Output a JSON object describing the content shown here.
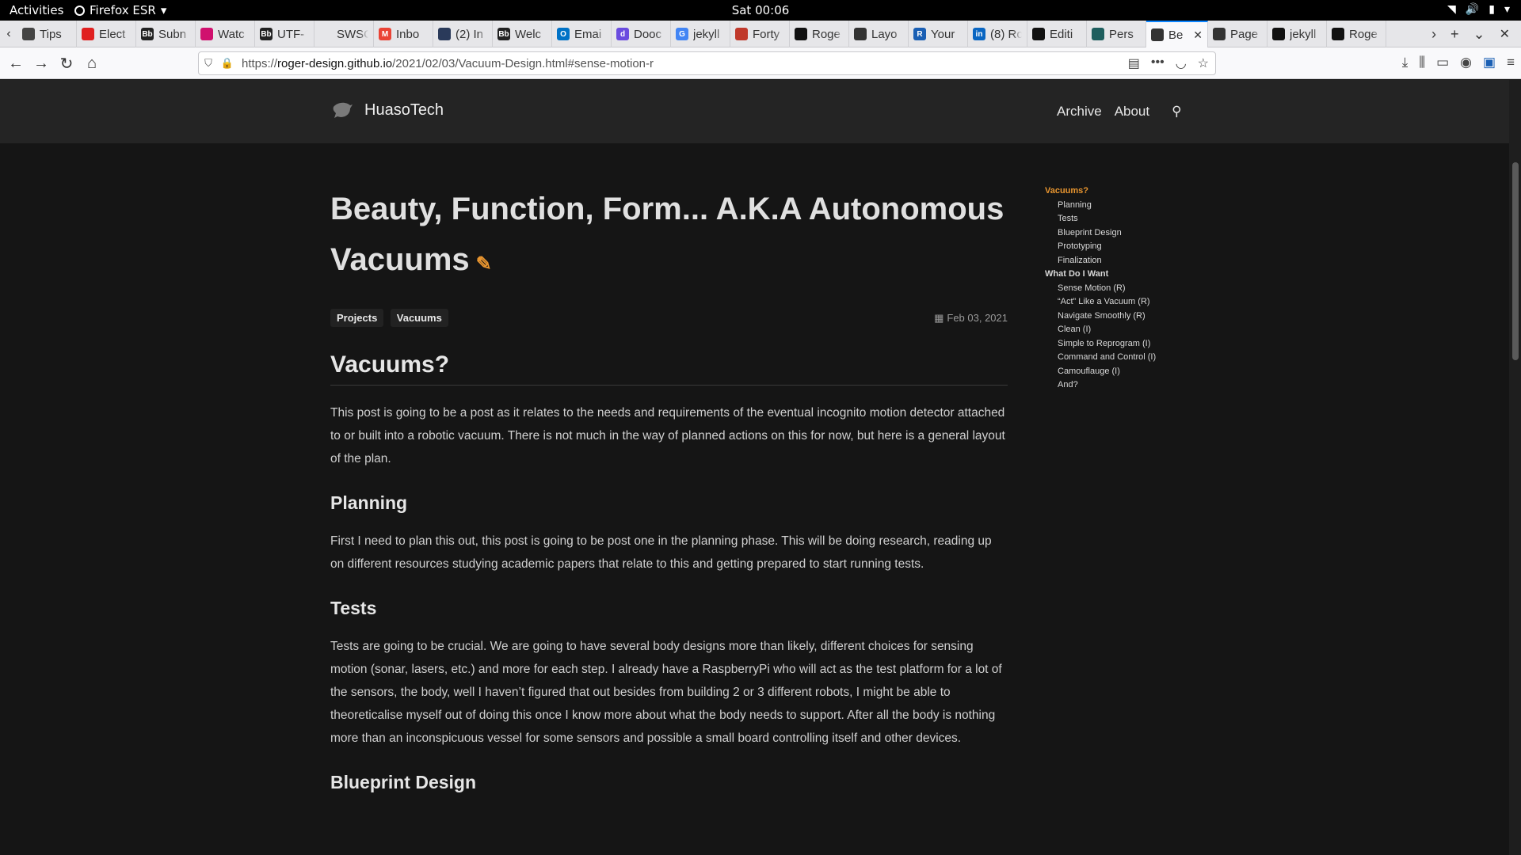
{
  "system": {
    "activities": "Activities",
    "app_name": "Firefox ESR",
    "clock": "Sat 00:06"
  },
  "tabs": [
    {
      "label": "Tips",
      "fav": "",
      "color": "#444444"
    },
    {
      "label": "Elect",
      "fav": "",
      "color": "#e02020"
    },
    {
      "label": "Subn",
      "fav": "Bb",
      "color": "#222222"
    },
    {
      "label": "Watc",
      "fav": "",
      "color": "#d0106e"
    },
    {
      "label": "UTF-",
      "fav": "Bb",
      "color": "#222222"
    },
    {
      "label": "SWSCU",
      "fav": "",
      "color": "#e6e6e9"
    },
    {
      "label": "Inbo",
      "fav": "M",
      "color": "#ea4335"
    },
    {
      "label": "(2) In",
      "fav": "",
      "color": "#2a3a5a"
    },
    {
      "label": "Welc",
      "fav": "Bb",
      "color": "#222222"
    },
    {
      "label": "Emai",
      "fav": "O",
      "color": "#0072c6"
    },
    {
      "label": "Dooc",
      "fav": "d",
      "color": "#6a4cdf"
    },
    {
      "label": "jekyll",
      "fav": "G",
      "color": "#4285f4"
    },
    {
      "label": "Forty",
      "fav": "",
      "color": "#c0392b"
    },
    {
      "label": "Roge",
      "fav": "",
      "color": "#111111"
    },
    {
      "label": "Layo",
      "fav": "",
      "color": "#333333"
    },
    {
      "label": "Your",
      "fav": "R",
      "color": "#1a5fb4"
    },
    {
      "label": "(8) Ro",
      "fav": "in",
      "color": "#0a66c2"
    },
    {
      "label": "Editi",
      "fav": "",
      "color": "#111111"
    },
    {
      "label": "Pers",
      "fav": "",
      "color": "#1e5e5e"
    },
    {
      "label": "Be",
      "fav": "",
      "color": "#333333",
      "active": true
    },
    {
      "label": "Page",
      "fav": "",
      "color": "#333333"
    },
    {
      "label": "jekyll",
      "fav": "",
      "color": "#111111"
    },
    {
      "label": "Roge",
      "fav": "",
      "color": "#111111"
    }
  ],
  "url": {
    "scheme": "https://",
    "host": "roger-design.github.io",
    "path": "/2021/02/03/Vacuum-Design.html#sense-motion-r"
  },
  "site": {
    "brand": "HuasoTech",
    "nav": [
      "Archive",
      "About"
    ]
  },
  "post": {
    "title": "Beauty, Function, Form... A.K.A Autonomous Vacuums",
    "tags": [
      "Projects",
      "Vacuums"
    ],
    "date": "Feb 03, 2021",
    "h_vacuums": "Vacuums?",
    "p_vacuums": "This post is going to be a post as it relates to the needs and requirements of the eventual incognito motion detector attached to or built into a robotic vacuum. There is not much in the way of planned actions on this for now, but here is a general layout of the plan.",
    "h_planning": "Planning",
    "p_planning": "First I need to plan this out, this post is going to be post one in the planning phase. This will be doing research, reading up on different resources studying academic papers that relate to this and getting prepared to start running tests.",
    "h_tests": "Tests",
    "p_tests": "Tests are going to be crucial. We are going to have several body designs more than likely, different choices for sensing motion (sonar, lasers, etc.) and more for each step. I already have a RaspberryPi who will act as the test platform for a lot of the sensors, the body, well I haven’t figured that out besides from building 2 or 3 different robots, I might be able to theoreticalise myself out of doing this once I know more about what the body needs to support. After all the body is nothing more than an inconspicuous vessel for some sensors and possible a small board controlling itself and other devices.",
    "h_blueprint": "Blueprint Design"
  },
  "toc": {
    "vacuums": "Vacuums?",
    "vacuums_items": [
      "Planning",
      "Tests",
      "Blueprint Design",
      "Prototyping",
      "Finalization"
    ],
    "want": "What Do I Want",
    "want_items": [
      "Sense Motion (R)",
      "“Act” Like a Vacuum (R)",
      "Navigate Smoothly (R)",
      "Clean (I)",
      "Simple to Reprogram (I)",
      "Command and Control (I)",
      "Camouflauge (I)",
      "And?"
    ]
  },
  "colors": {
    "accent": "#e8952f",
    "page_bg": "#151515",
    "header_bg": "#242424"
  }
}
